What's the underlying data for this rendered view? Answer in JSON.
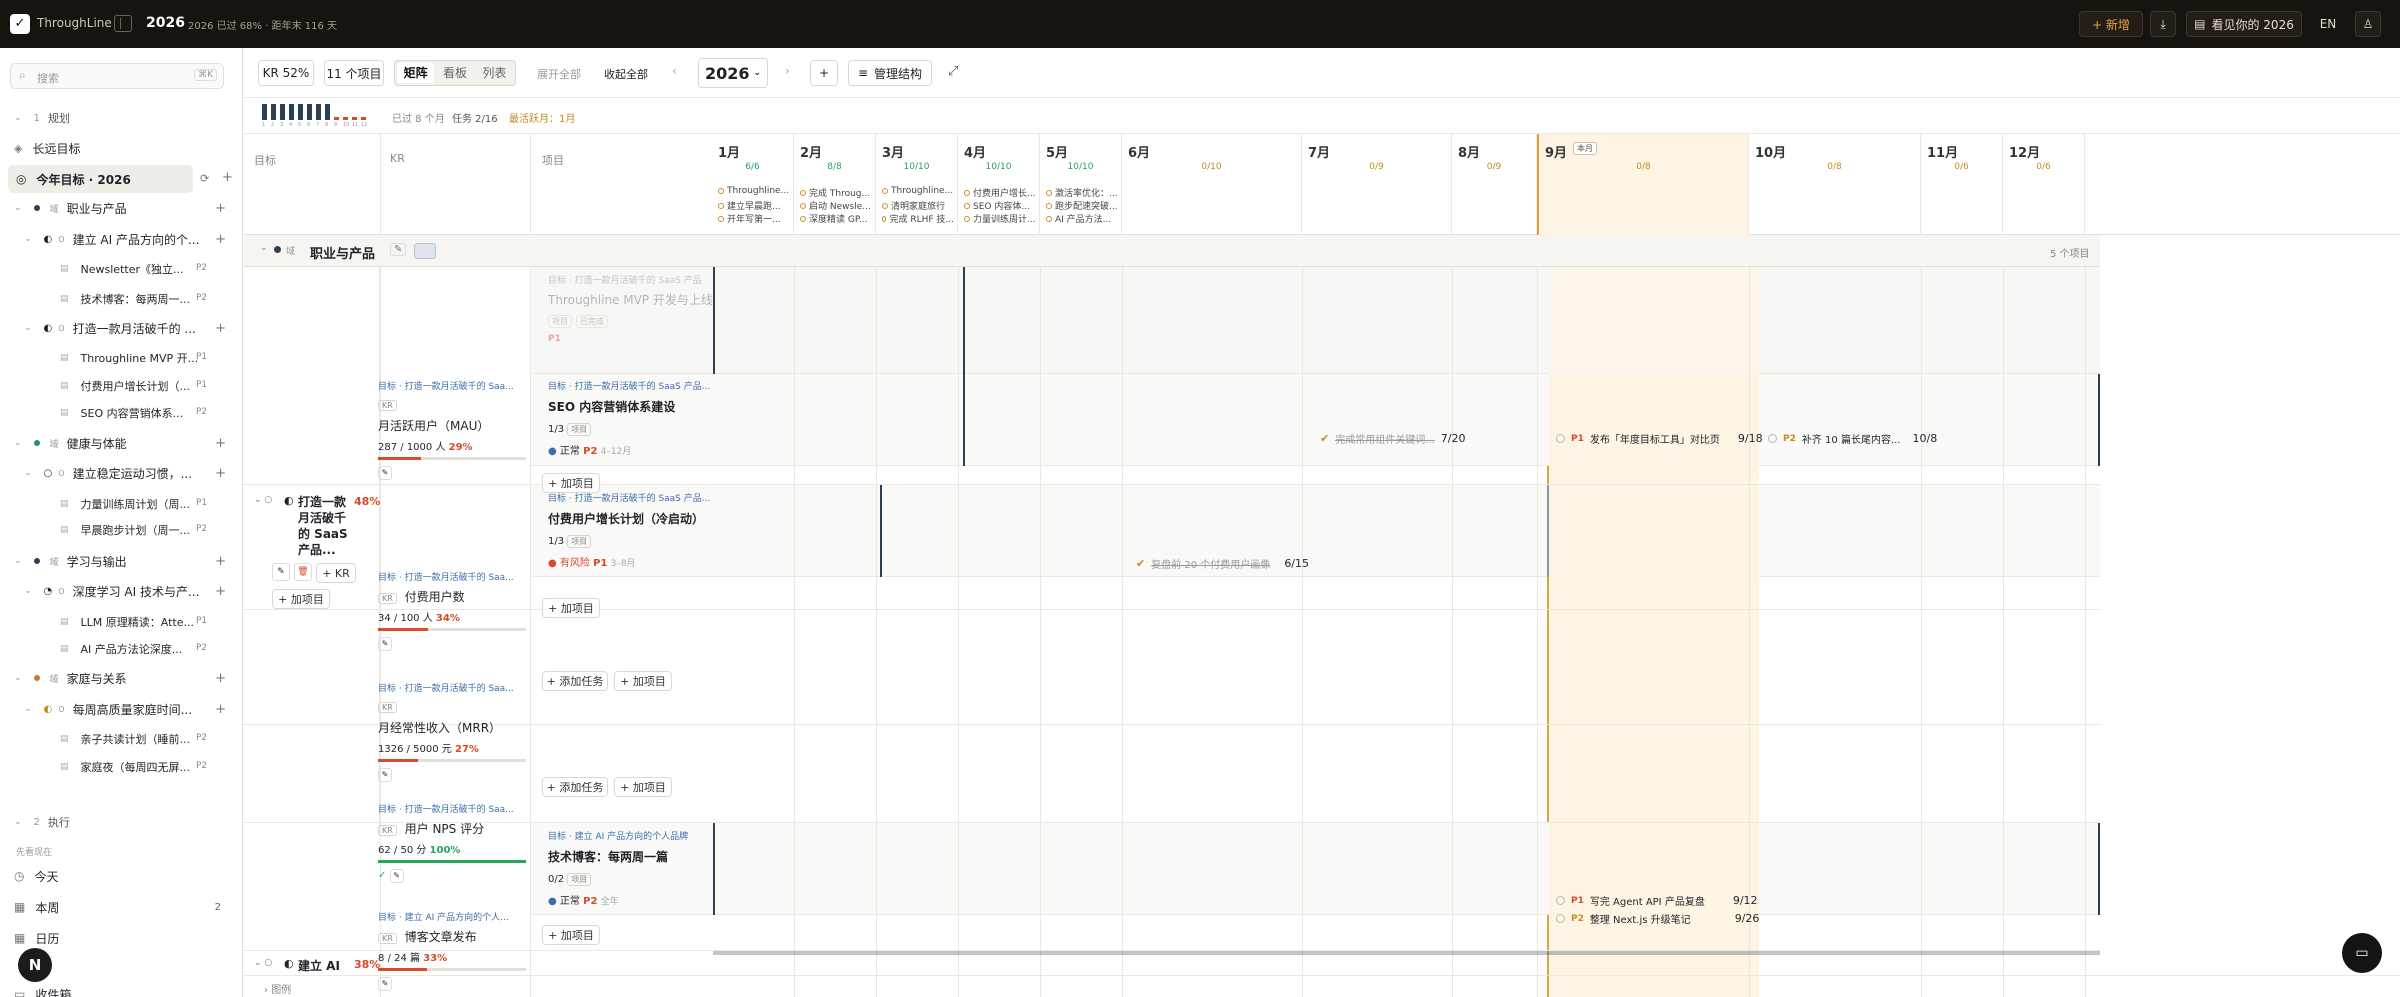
{
  "app": {
    "name": "ThroughLine",
    "year": "2026",
    "progress_text": "2026 已过 68% · 距年末 116 天",
    "new_label": "+ 新增",
    "see_label": "看见你的 2026",
    "lang": "EN"
  },
  "sidebar": {
    "search_placeholder": "搜索",
    "search_shortcut": "⌘K",
    "section1_num": "1",
    "section1_title": "规划",
    "long_term": "长远目标",
    "this_year": "今年目标 · 2026",
    "areas": [
      {
        "name": "职业与产品",
        "goals": [
          {
            "name": "建立 AI 产品方向的个...",
            "projects": [
              {
                "name": "Newsletter《独立...",
                "pr": "P2"
              },
              {
                "name": "技术博客：每两周一...",
                "pr": "P2"
              }
            ]
          },
          {
            "name": "打造一款月活破千的 ...",
            "projects": [
              {
                "name": "Throughline MVP 开...",
                "pr": "P1"
              },
              {
                "name": "付费用户增长计划（...",
                "pr": "P1"
              },
              {
                "name": "SEO 内容营销体系...",
                "pr": "P2"
              }
            ]
          }
        ]
      },
      {
        "name": "健康与体能",
        "goals": [
          {
            "name": "建立稳定运动习惯，...",
            "projects": [
              {
                "name": "力量训练周计划（周...",
                "pr": "P1"
              },
              {
                "name": "早晨跑步计划（周一...",
                "pr": "P2"
              }
            ]
          }
        ]
      },
      {
        "name": "学习与输出",
        "goals": [
          {
            "name": "深度学习 AI 技术与产...",
            "projects": [
              {
                "name": "LLM 原理精读：Atte...",
                "pr": "P1"
              },
              {
                "name": "AI 产品方法论深度...",
                "pr": "P2"
              }
            ]
          }
        ]
      },
      {
        "name": "家庭与关系",
        "goals": [
          {
            "name": "每周高质量家庭时间...",
            "projects": [
              {
                "name": "亲子共读计划（睡前...",
                "pr": "P2"
              },
              {
                "name": "家庭夜（每周四无屏...",
                "pr": "P2"
              }
            ]
          }
        ]
      }
    ],
    "section2_num": "2",
    "section2_title": "执行",
    "see_now": "先看现在",
    "today": "今天",
    "this_week": "本周",
    "this_week_count": "2",
    "calendar": "日历",
    "inbox": "收件箱",
    "avatar_letter": "N"
  },
  "toolbar": {
    "kr_pct": "KR 52%",
    "items": "11 个项目",
    "views": [
      "矩阵",
      "看板",
      "列表"
    ],
    "expand_all": "展开全部",
    "collapse_all": "收起全部",
    "year": "2026",
    "manage": "管理结构"
  },
  "stats": {
    "passed": "已过 8 个月",
    "tasks": "任务 2/16",
    "most_active": "最活跃月：1月",
    "mini_bars": [
      5,
      5,
      5,
      5,
      5,
      5,
      5,
      5,
      1,
      1,
      1,
      1
    ],
    "mini_labels": [
      "1",
      "2",
      "3",
      "4",
      "5",
      "6",
      "7",
      "8",
      "9",
      "10",
      "11",
      "12"
    ]
  },
  "columns": {
    "goal": "目标",
    "kr": "KR",
    "project": "项目"
  },
  "months": [
    {
      "name": "1月",
      "prog": "6/6",
      "tasks": [
        "Throughline...",
        "建立早晨跑...",
        "开年写第一..."
      ]
    },
    {
      "name": "2月",
      "prog": "8/8",
      "tasks": [
        "完成 Throug...",
        "启动 Newsle...",
        "深度精读 GP..."
      ]
    },
    {
      "name": "3月",
      "prog": "10/10",
      "tasks": [
        "Throughline...",
        "清明家庭旅行",
        "完成 RLHF 技..."
      ]
    },
    {
      "name": "4月",
      "prog": "10/10",
      "tasks": [
        "付费用户增长...",
        "SEO 内容体...",
        "力量训练周计..."
      ]
    },
    {
      "name": "5月",
      "prog": "10/10",
      "tasks": [
        "激活率优化：...",
        "跑步配速突破...",
        "AI 产品方法..."
      ]
    },
    {
      "name": "6月",
      "prog": "0/10",
      "tasks": []
    },
    {
      "name": "7月",
      "prog": "0/9",
      "tasks": []
    },
    {
      "name": "8月",
      "prog": "0/9",
      "tasks": []
    },
    {
      "name": "9月",
      "prog": "0/8",
      "tasks": [],
      "badge": "本月"
    },
    {
      "name": "10月",
      "prog": "0/8",
      "tasks": []
    },
    {
      "name": "11月",
      "prog": "0/6",
      "tasks": []
    },
    {
      "name": "12月",
      "prog": "0/6",
      "tasks": []
    }
  ],
  "group": {
    "name": "职业与产品",
    "count": "5 个项目"
  },
  "goal_block": {
    "name": "打造一款月活破千的 SaaS 产品...",
    "pct": "48%",
    "kr_btn": "+ KR",
    "add_project": "+ 加项目"
  },
  "goal2": {
    "name": "建立 AI",
    "pct": "38%"
  },
  "krs": [
    {
      "crumb": "目标 · 打造一款月活破千的 Saa...",
      "tag": "KR",
      "name": "月活跃用户（MAU）",
      "val": "287 / 1000 人",
      "pct": "29%",
      "fill": 0.29
    },
    {
      "crumb": "目标 · 打造一款月活破千的 Saa...",
      "tag": "KR",
      "name": "付费用户数",
      "val": "34 / 100 人",
      "pct": "34%",
      "fill": 0.34
    },
    {
      "crumb": "目标 · 打造一款月活破千的 Saa...",
      "tag": "KR",
      "name": "月经常性收入（MRR）",
      "val": "1326 / 5000 元",
      "pct": "27%",
      "fill": 0.27
    },
    {
      "crumb": "目标 · 打造一款月活破千的 Saa...",
      "tag": "KR",
      "name": "用户 NPS 评分",
      "val": "62 / 50 分",
      "pct": "100%",
      "fill": 1
    },
    {
      "crumb": "目标 · 建立 AI 产品方向的个人...",
      "tag": "KR",
      "name": "博客文章发布",
      "val": "8 / 24 篇",
      "pct": "33%",
      "fill": 0.33
    }
  ],
  "projects": [
    {
      "crumb": "目标 · 打造一款月活破千的 SaaS 产品",
      "name": "Throughline MVP 开发与上线",
      "tag1": "项目",
      "tag2": "已完成",
      "pr": "P1"
    },
    {
      "crumb": "目标 · 打造一款月活破千的 SaaS 产品...",
      "name": "SEO 内容营销体系建设",
      "count": "1/3",
      "tag1": "项目",
      "status": "正常",
      "pr": "P2",
      "range": "4–12月"
    },
    {
      "crumb": "目标 · 打造一款月活破千的 SaaS 产品...",
      "name": "付费用户增长计划（冷启动）",
      "count": "1/3",
      "tag1": "项目",
      "status": "有风险",
      "pr": "P1",
      "range": "3–8月"
    },
    {
      "crumb": "目标 · 建立 AI 产品方向的个人品牌",
      "name": "技术博客：每两周一篇",
      "count": "0/2",
      "tag1": "项目",
      "status": "正常",
      "pr": "P2",
      "range": "全年"
    }
  ],
  "buttons": {
    "add_project": "+ 加项目",
    "add_task": "+ 添加任务"
  },
  "tasks": {
    "seo_done": "完成常用组件关键词...",
    "seo_done_date": "7/20",
    "seo_t1": "发布「年度目标工具」对比页",
    "seo_t1_date": "9/18",
    "seo_t1_pr": "P1",
    "seo_t2": "补齐 10 篇长尾内容...",
    "seo_t2_date": "10/8",
    "seo_t2_pr": "P2",
    "pay_done": "复盘前 20 个付费用户画像",
    "pay_done_date": "6/15",
    "blog_t1": "写完 Agent API 产品复盘",
    "blog_t1_date": "9/12",
    "blog_t1_pr": "P1",
    "blog_t2": "整理 Next.js 升级笔记",
    "blog_t2_date": "9/26",
    "blog_t2_pr": "P2"
  },
  "footer": {
    "legend": "图例"
  }
}
